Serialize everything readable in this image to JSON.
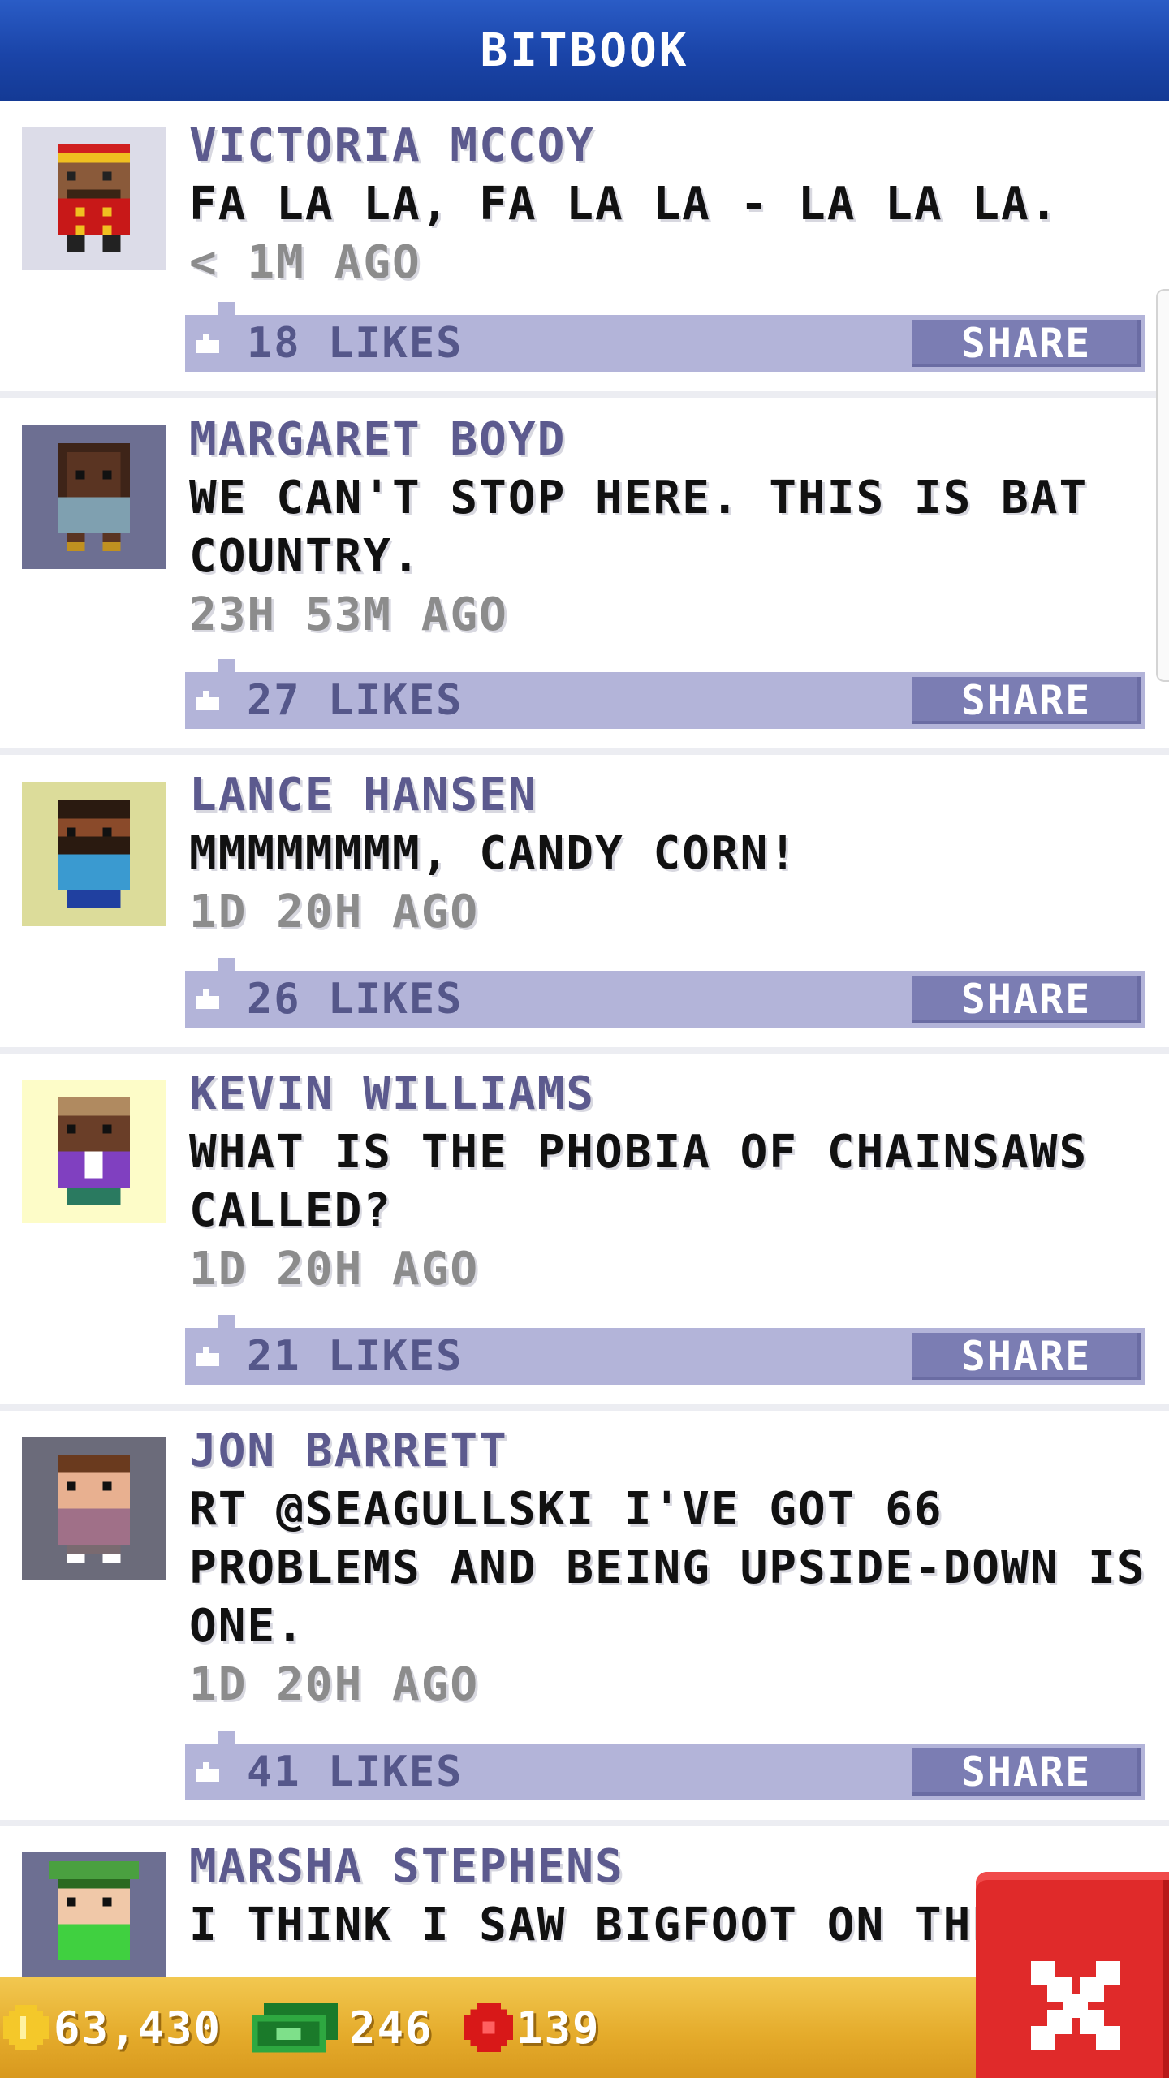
{
  "header": {
    "title": "BITBOOK"
  },
  "posts": [
    {
      "name": "VICTORIA MCCOY",
      "lines": [
        "FA LA LA, FA LA LA - LA LA LA."
      ],
      "time": "< 1M AGO",
      "likes": "18 LIKES",
      "share": "SHARE",
      "avatar_bg": "#dcdce8"
    },
    {
      "name": "MARGARET BOYD",
      "lines": [
        "WE CAN'T STOP HERE. THIS IS BAT",
        "COUNTRY."
      ],
      "time": "23H 53M AGO",
      "likes": "27 LIKES",
      "share": "SHARE",
      "avatar_bg": "#6d6f92"
    },
    {
      "name": "LANCE HANSEN",
      "lines": [
        "MMMMMMMM, CANDY CORN!"
      ],
      "time": "1D 20H AGO",
      "likes": "26 LIKES",
      "share": "SHARE",
      "avatar_bg": "#dcdc9a"
    },
    {
      "name": "KEVIN WILLIAMS",
      "lines": [
        "WHAT IS THE PHOBIA OF CHAINSAWS",
        "CALLED?"
      ],
      "time": "1D 20H AGO",
      "likes": "21 LIKES",
      "share": "SHARE",
      "avatar_bg": "#fdfcc8"
    },
    {
      "name": "JON BARRETT",
      "lines": [
        "RT @SEAGULLSKI I'VE GOT 66",
        "PROBLEMS AND BEING UPSIDE-DOWN IS",
        "ONE."
      ],
      "time": "1D 20H AGO",
      "likes": "41 LIKES",
      "share": "SHARE",
      "avatar_bg": "#6b6b7a"
    },
    {
      "name": "MARSHA STEPHENS",
      "lines": [
        "I THINK I SAW BIGFOOT ON THE N"
      ],
      "time": "",
      "likes": "",
      "share": "",
      "avatar_bg": "#6d6f92"
    }
  ],
  "footer": {
    "coins": "63,430",
    "bux": "246",
    "tokens": "139"
  },
  "colors": {
    "header": "#1a44a8",
    "bar": "#b3b4d9",
    "share": "#7b7db3",
    "name": "#5c5a8e",
    "footer": "#e4aa2a",
    "close": "#e02a2a"
  },
  "icons": {
    "like": "thumbs-up-icon",
    "coin": "coin-icon",
    "bux": "bux-icon",
    "token": "token-icon",
    "close": "close-icon"
  }
}
